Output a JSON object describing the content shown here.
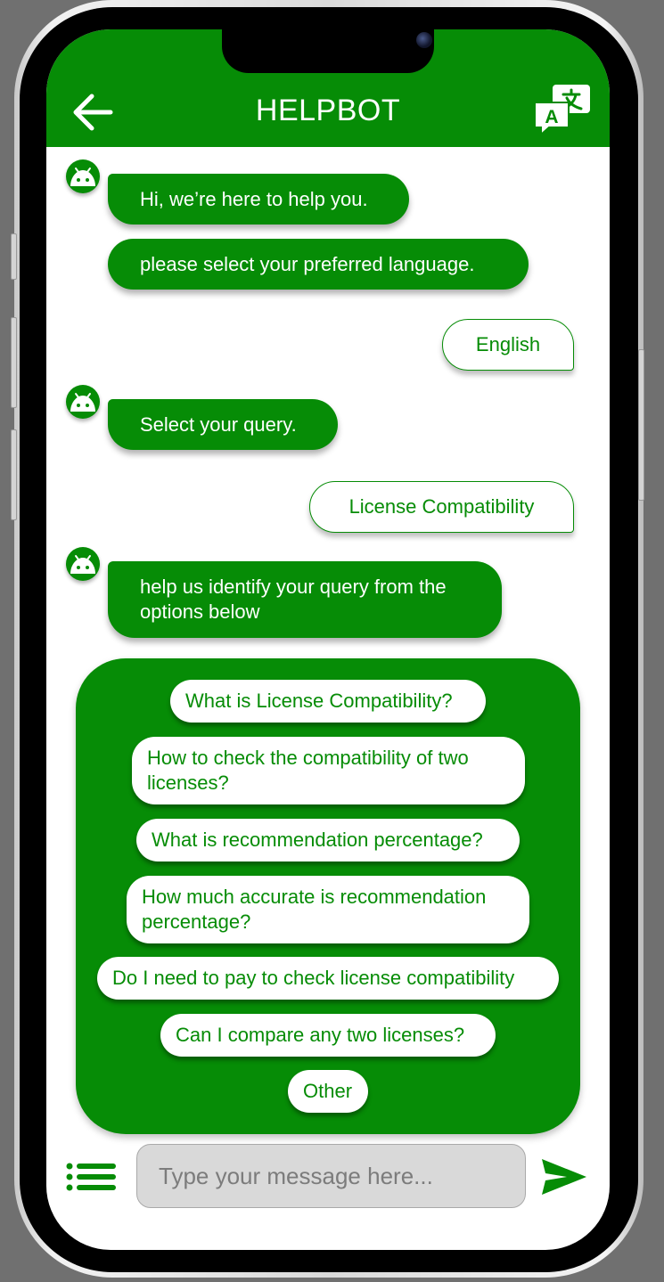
{
  "header": {
    "title": "HELPBOT",
    "back_icon": "arrow-left-icon",
    "translate_icon": "translate-icon"
  },
  "chat": {
    "greeting": "Hi, we’re here to help you.",
    "language_prompt": "please select your preferred language.",
    "language_reply": "English",
    "query_prompt": "Select your query.",
    "query_reply": "License Compatibility",
    "identify_prompt": "help us identify your query from the options below"
  },
  "options": [
    "What is License Compatibility?",
    "How to check the compatibility of two licenses?",
    "What is recommendation percentage?",
    "How much accurate is recommendation percentage?",
    "Do I need to pay to check license compatibility",
    "Can I compare any two licenses?",
    "Other"
  ],
  "composer": {
    "placeholder": "Type your message here...",
    "menu_icon": "list-menu-icon",
    "send_icon": "send-icon"
  },
  "colors": {
    "accent": "#068c06",
    "background": "#ffffff",
    "input_bg": "#d9d9d9",
    "outer_bg": "#707070"
  }
}
